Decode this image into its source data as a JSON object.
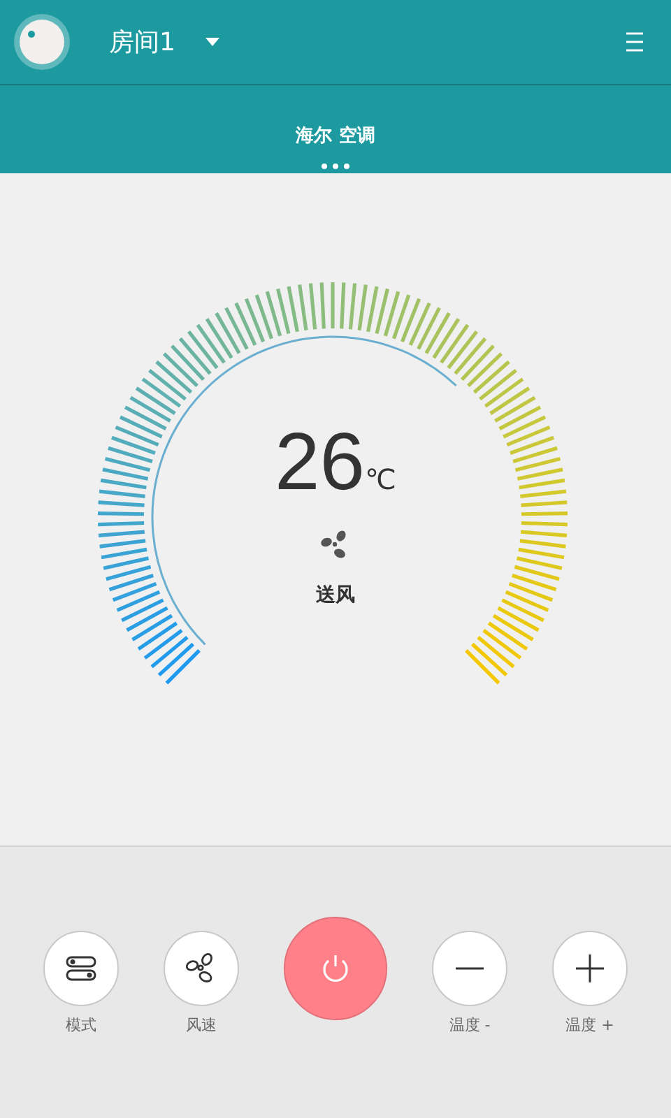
{
  "header": {
    "room": "房间1",
    "device": "海尔 空调"
  },
  "thermostat": {
    "temperature": "26",
    "unit": "℃",
    "mode": "送风"
  },
  "controls": [
    {
      "kind": "mode",
      "label": "模式"
    },
    {
      "kind": "fan",
      "label": "风速"
    },
    {
      "kind": "power"
    },
    {
      "kind": "minus",
      "label": "温度 -"
    },
    {
      "kind": "plus",
      "label": "温度 +"
    }
  ]
}
